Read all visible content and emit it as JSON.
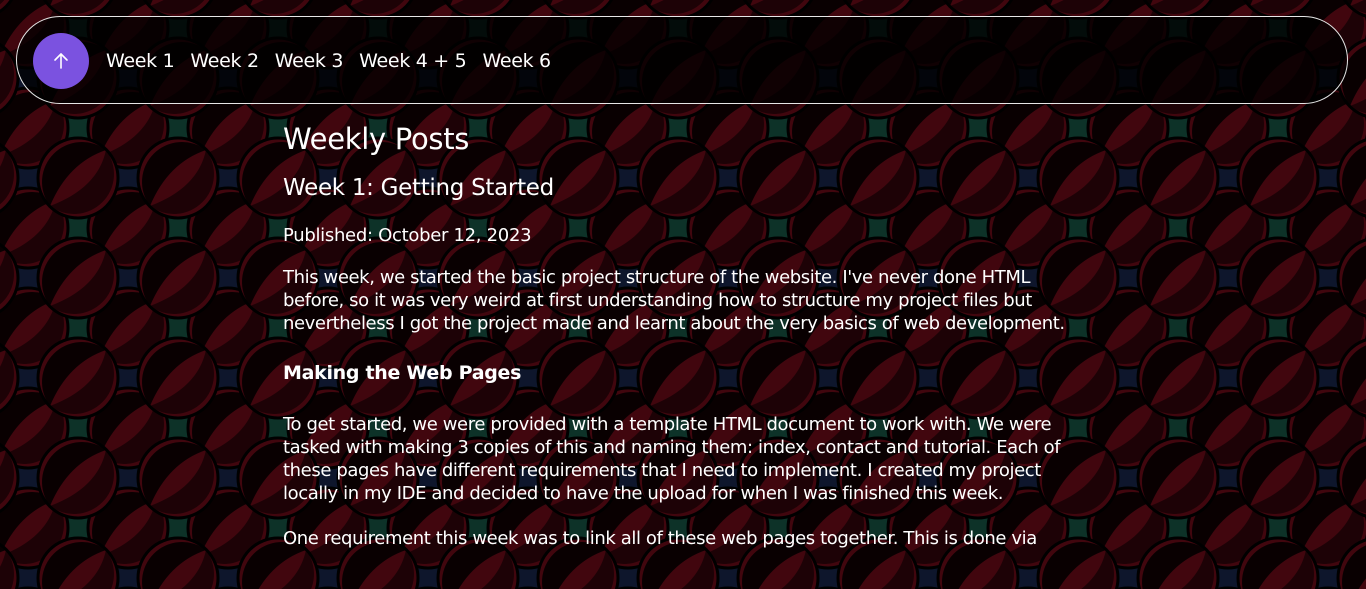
{
  "nav": {
    "up_button_label": "Scroll to top",
    "links": [
      {
        "label": "Week 1"
      },
      {
        "label": "Week 2"
      },
      {
        "label": "Week 3"
      },
      {
        "label": "Week 4 + 5"
      },
      {
        "label": "Week 6"
      }
    ]
  },
  "main": {
    "page_title": "Weekly Posts",
    "post": {
      "title": "Week 1: Getting Started",
      "published": "Published: October 12, 2023",
      "intro": "This week, we started the basic project structure of the website. I've never done HTML before, so it was very weird at first understanding how to structure my project files but nevertheless I got the project made and learnt about the very basics of web development.",
      "section_heading": "Making the Web Pages",
      "section_para": "To get started, we were provided with a template HTML document to work with. We were tasked with making 3 copies of this and naming them: index, contact and tutorial. Each of these pages have different requirements that I need to implement. I created my project locally in my IDE and decided to have the upload for when I was finished this week.",
      "next_para": "One requirement this week was to link all of these web pages together. This is done via"
    }
  },
  "colors": {
    "accent": "#7b52e0",
    "background": "#0a0f1c",
    "pattern_red": "#4a0710",
    "pattern_green": "#0f3a2e",
    "pattern_blue": "#101a33"
  },
  "icons": {
    "up_button": "arrow-up-icon"
  }
}
